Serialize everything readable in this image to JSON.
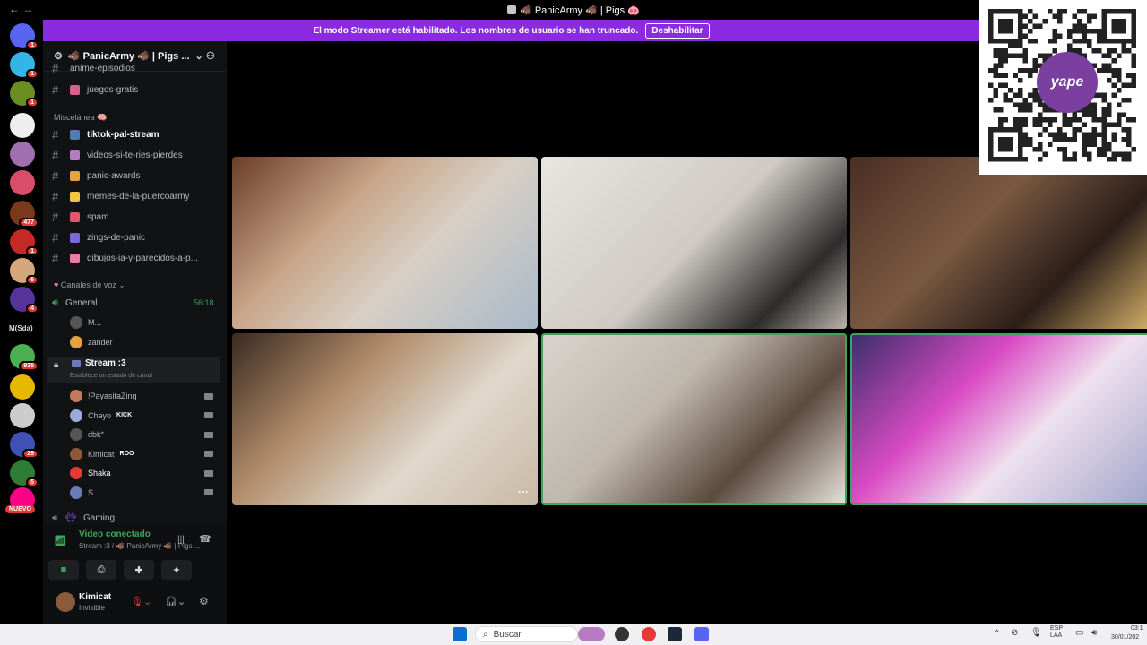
{
  "window": {
    "title": "🐗 PanicArmy 🐗 | Pigs 🐽"
  },
  "banner": {
    "text": "El modo Streamer está habilitado. Los nombres de usuario se han truncado.",
    "button": "Deshabilitar"
  },
  "server": {
    "name": "🐗 PanicArmy 🐗 | Pigs ..."
  },
  "rail": {
    "badges": [
      "1",
      "1",
      "1",
      "477",
      "1",
      "6",
      "4",
      "935",
      "29",
      "5"
    ],
    "msda_label": "M(Sda)",
    "new_label": "NUEVO"
  },
  "channels": {
    "partial": "anime-episodios",
    "juegos": "juegos-gratis",
    "category_misc": "Miscelánea 🧠",
    "text_channels": [
      {
        "name": "tiktok-pal-stream",
        "color": "#4f7cb8",
        "active": true
      },
      {
        "name": "videos-si-te-ries-pierdes",
        "color": "#b77bc3",
        "active": false
      },
      {
        "name": "panic-awards",
        "color": "#e6a23c",
        "active": false
      },
      {
        "name": "memes-de-la-puercoarmy",
        "color": "#f4c542",
        "active": false
      },
      {
        "name": "spam",
        "color": "#e2566c",
        "active": false
      },
      {
        "name": "zings-de-panic",
        "color": "#7e68d8",
        "active": false
      },
      {
        "name": "dibujos-ia-y-parecidos-a-p...",
        "color": "#e97ba5",
        "active": false
      }
    ],
    "category_voice": "Canales de voz",
    "general": {
      "name": "General",
      "timer": "56:18"
    },
    "general_users": [
      "M...",
      "zander"
    ],
    "stream": {
      "name": "Stream :3",
      "status": "Establece un estado de canal"
    },
    "stream_users": [
      {
        "name": "!PayasitaZing",
        "tag": ""
      },
      {
        "name": "Chayo",
        "tag": "KICK"
      },
      {
        "name": "dbk*",
        "tag": ""
      },
      {
        "name": "Kimicat",
        "tag": "ROO"
      },
      {
        "name": "Shaka",
        "tag": ""
      },
      {
        "name": "S...",
        "tag": ""
      }
    ],
    "gaming": "Gaming"
  },
  "voice_panel": {
    "status": "Video conectado",
    "location": "Stream :3 / 🐗 PanicArmy 🐗 | Pigs ...",
    "user": "Kimicat",
    "user_status": "Invisible"
  },
  "tiles": [
    {
      "name": "tile-1",
      "speaking": false
    },
    {
      "name": "tile-2",
      "speaking": false
    },
    {
      "name": "tile-3",
      "speaking": false
    },
    {
      "name": "tile-4",
      "speaking": false
    },
    {
      "name": "tile-5",
      "speaking": true
    },
    {
      "name": "tile-6",
      "speaking": true
    }
  ],
  "qr": {
    "brand": "yape"
  },
  "taskbar": {
    "search_placeholder": "Buscar",
    "lang": "ESP\nLAA",
    "time": "03:1",
    "date": "30/01/202"
  },
  "colors": {
    "banner": "#8a2be2",
    "accent_green": "#3ba55c",
    "sidebar": "#111214"
  }
}
